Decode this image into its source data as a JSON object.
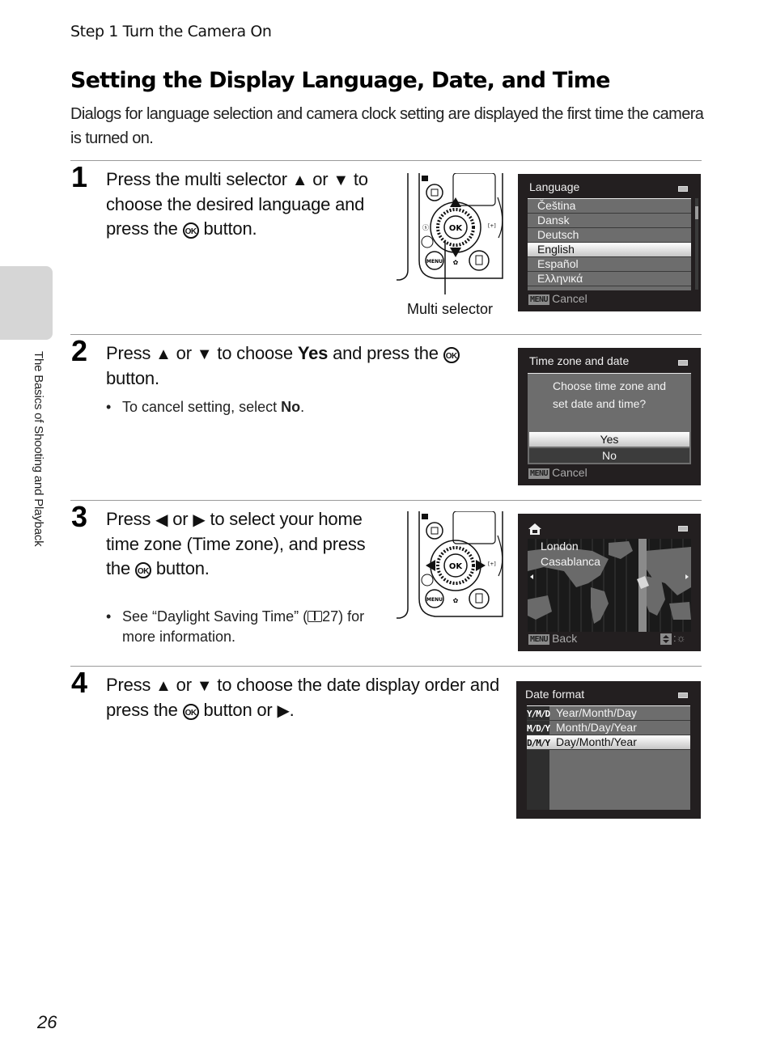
{
  "running_head": "Step 1 Turn the Camera On",
  "title": "Setting the Display Language, Date, and Time",
  "intro": "Dialogs for language selection and camera clock setting are displayed the first time the camera is turned on.",
  "side_tab_label": "The Basics of Shooting and Playback",
  "page_number": "26",
  "glyphs": {
    "up": "▲",
    "down": "▼",
    "left": "◀",
    "right": "▶",
    "ok": "OK"
  },
  "steps": [
    {
      "number": "1",
      "text_parts": [
        "Press the multi selector ",
        " or ",
        " to choose the desired language and press the ",
        " button."
      ],
      "caption": "Multi selector",
      "screen": {
        "title": "Language",
        "items": [
          "Čeština",
          "Dansk",
          "Deutsch",
          "English",
          "Español",
          "Ελληνικά"
        ],
        "selected": "English",
        "footer_badge": "MENU",
        "footer_label": "Cancel"
      }
    },
    {
      "number": "2",
      "text_parts": [
        "Press ",
        " or ",
        " to choose ",
        "Yes",
        " and press the ",
        " button."
      ],
      "bullet_parts": [
        "To cancel setting, select ",
        "No",
        "."
      ],
      "screen": {
        "title": "Time zone and date",
        "question_line1": "Choose time zone and",
        "question_line2": "set date and time?",
        "options": [
          "Yes",
          "No"
        ],
        "selected": "Yes",
        "footer_badge": "MENU",
        "footer_label": "Cancel"
      }
    },
    {
      "number": "3",
      "text_parts": [
        "Press ",
        " or ",
        " to select your home time zone (Time zone), and press the ",
        " button."
      ],
      "bullet_parts": [
        "See “Daylight Saving Time” (",
        "27) for more information."
      ],
      "screen": {
        "home_icon": "home-icon",
        "cities": [
          "London",
          "Casablanca"
        ],
        "footer_badge": "MENU",
        "footer_label": "Back",
        "footer_right_icons": [
          "up-down-icon",
          "daylight-saving-icon"
        ]
      }
    },
    {
      "number": "4",
      "text_parts": [
        "Press ",
        " or ",
        " to choose the date display order and press the ",
        " button or ",
        "."
      ],
      "screen": {
        "title": "Date format",
        "items": [
          {
            "code": "Y/M/D",
            "label": "Year/Month/Day"
          },
          {
            "code": "M/D/Y",
            "label": "Month/Day/Year"
          },
          {
            "code": "D/M/Y",
            "label": "Day/Month/Year"
          }
        ],
        "selected": "Day/Month/Year"
      }
    }
  ]
}
